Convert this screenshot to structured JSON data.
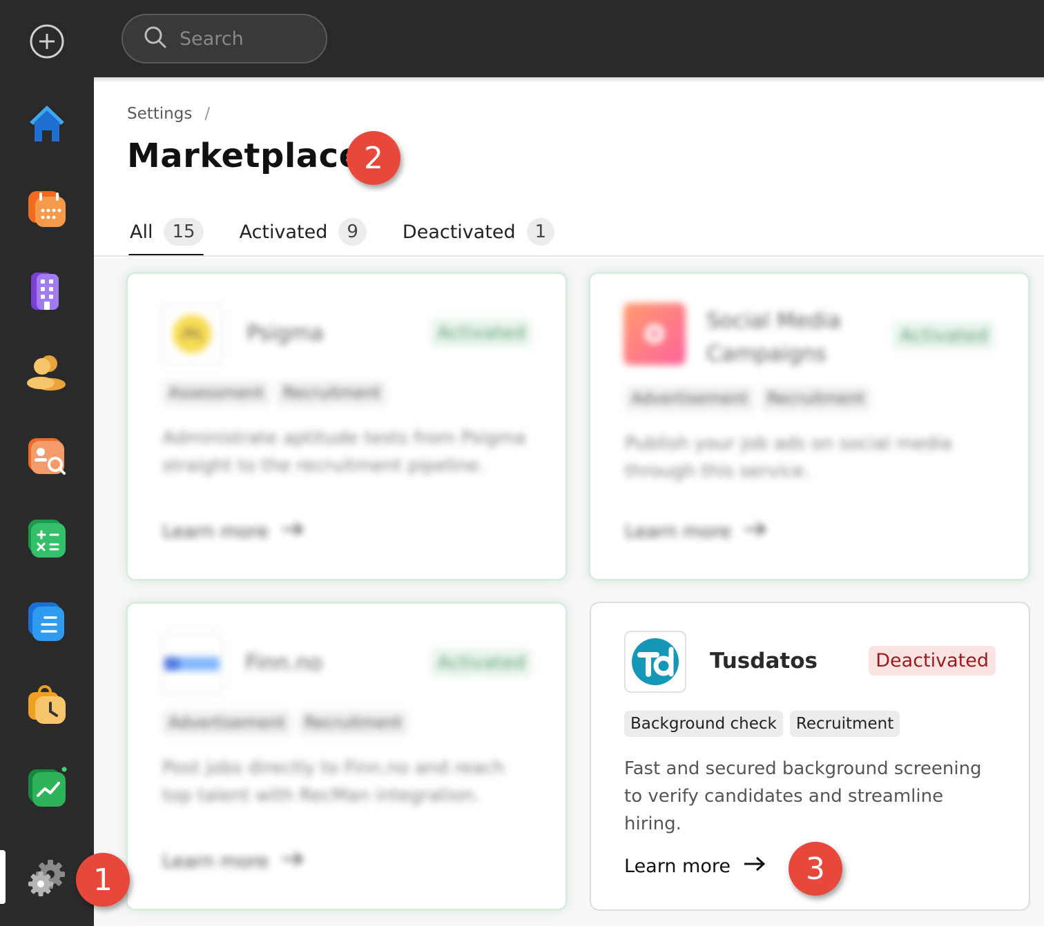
{
  "search": {
    "placeholder": "Search"
  },
  "sidebar": {
    "items": [
      {
        "name": "add-icon"
      },
      {
        "name": "home-icon"
      },
      {
        "name": "calendar-icon"
      },
      {
        "name": "building-icon"
      },
      {
        "name": "people-icon"
      },
      {
        "name": "candidate-search-icon"
      },
      {
        "name": "calculator-icon"
      },
      {
        "name": "document-icon"
      },
      {
        "name": "time-tracking-icon"
      },
      {
        "name": "analytics-icon"
      },
      {
        "name": "settings-gear-icon"
      }
    ]
  },
  "breadcrumb": {
    "parent": "Settings",
    "separator": "/"
  },
  "page": {
    "title": "Marketplace"
  },
  "tabs": [
    {
      "label": "All",
      "count": "15",
      "active": true
    },
    {
      "label": "Activated",
      "count": "9"
    },
    {
      "label": "Deactivated",
      "count": "1"
    }
  ],
  "cards": [
    {
      "name": "Psigma",
      "status": "Activated",
      "tags": [
        "Assessment",
        "Recruitment"
      ],
      "description": "Administrate aptitude tests from Psigma straight to the recruitment pipeline.",
      "cta": "Learn more"
    },
    {
      "name": "Social Media Campaigns",
      "status": "Activated",
      "tags": [
        "Advertisement",
        "Recruitment"
      ],
      "description": "Publish your job ads on social media through this service.",
      "cta": "Learn more"
    },
    {
      "name": "Finn.no",
      "status": "Activated",
      "tags": [
        "Advertisement",
        "Recruitment"
      ],
      "description": "Post jobs directly to Finn.no and reach top talent with RecMan integration.",
      "cta": "Learn more"
    },
    {
      "name": "Tusdatos",
      "status": "Deactivated",
      "tags": [
        "Background check",
        "Recruitment"
      ],
      "description": "Fast and secured background screening to verify candidates and streamline hiring.",
      "cta": "Learn more"
    }
  ],
  "markers": [
    "1",
    "2",
    "3"
  ],
  "colors": {
    "sidebar_bg": "#2b2a2a",
    "marker_red": "#e8483c",
    "activated_green": "#2e7d4c",
    "deactivated_red": "#9a1b1b"
  }
}
